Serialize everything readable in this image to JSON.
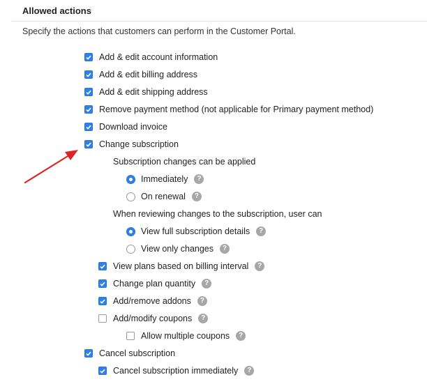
{
  "section": {
    "title": "Allowed actions",
    "description": "Specify the actions that customers can perform in the Customer Portal."
  },
  "options": {
    "account_info": {
      "label": "Add & edit account information",
      "checked": true
    },
    "billing_address": {
      "label": "Add & edit billing address",
      "checked": true
    },
    "shipping_address": {
      "label": "Add & edit shipping address",
      "checked": true
    },
    "remove_payment": {
      "label": "Remove payment method (not applicable for Primary payment method)",
      "checked": true
    },
    "download_invoice": {
      "label": "Download invoice",
      "checked": true
    },
    "change_subscription": {
      "label": "Change subscription",
      "checked": true
    }
  },
  "change_subscription": {
    "apply_heading": "Subscription changes can be applied",
    "apply_options": [
      {
        "label": "Immediately",
        "selected": true
      },
      {
        "label": "On renewal",
        "selected": false
      }
    ],
    "review_heading": "When reviewing changes to the subscription, user can",
    "review_options": [
      {
        "label": "View full subscription details",
        "selected": true
      },
      {
        "label": "View only changes",
        "selected": false
      }
    ],
    "view_plans": {
      "label": "View plans based on billing interval",
      "checked": true
    },
    "plan_quantity": {
      "label": "Change plan quantity",
      "checked": true
    },
    "addons": {
      "label": "Add/remove addons",
      "checked": true
    },
    "coupons": {
      "label": "Add/modify coupons",
      "checked": false
    },
    "multiple_coupons": {
      "label": "Allow multiple coupons",
      "checked": false
    }
  },
  "cancel": {
    "cancel_subscription": {
      "label": "Cancel subscription",
      "checked": true
    },
    "cancel_immediately": {
      "label": "Cancel subscription immediately",
      "checked": true
    }
  },
  "help_glyph": "?",
  "icons": {
    "help": "question-circle-icon",
    "annotation": "red-arrow-icon"
  },
  "colors": {
    "accent": "#2f80e8",
    "help": "#a7a7a7",
    "arrow": "#e02424"
  }
}
